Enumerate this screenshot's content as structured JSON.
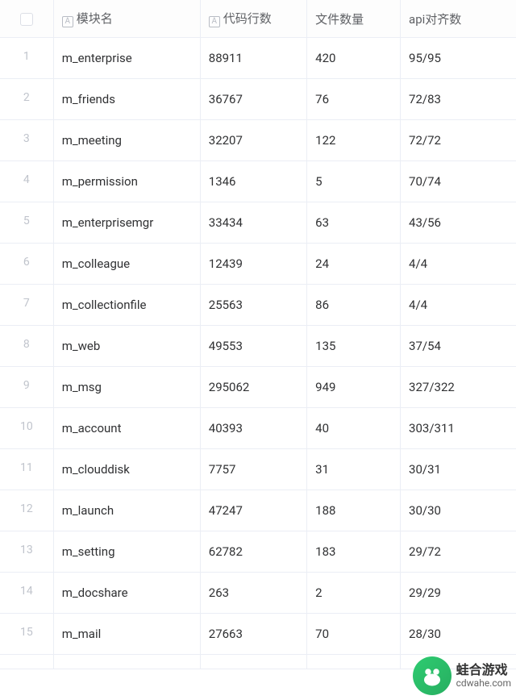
{
  "headers": {
    "module": "模块名",
    "lines": "代码行数",
    "files": "文件数量",
    "api": "api对齐数"
  },
  "rows": [
    {
      "idx": "1",
      "module": "m_enterprise",
      "lines": "88911",
      "files": "420",
      "api": "95/95"
    },
    {
      "idx": "2",
      "module": "m_friends",
      "lines": "36767",
      "files": "76",
      "api": "72/83"
    },
    {
      "idx": "3",
      "module": "m_meeting",
      "lines": "32207",
      "files": "122",
      "api": "72/72"
    },
    {
      "idx": "4",
      "module": "m_permission",
      "lines": "1346",
      "files": "5",
      "api": "70/74"
    },
    {
      "idx": "5",
      "module": "m_enterprisemgr",
      "lines": "33434",
      "files": "63",
      "api": "43/56"
    },
    {
      "idx": "6",
      "module": "m_colleague",
      "lines": "12439",
      "files": "24",
      "api": "4/4"
    },
    {
      "idx": "7",
      "module": "m_collectionfile",
      "lines": "25563",
      "files": "86",
      "api": "4/4"
    },
    {
      "idx": "8",
      "module": "m_web",
      "lines": "49553",
      "files": "135",
      "api": "37/54"
    },
    {
      "idx": "9",
      "module": "m_msg",
      "lines": "295062",
      "files": "949",
      "api": "327/322"
    },
    {
      "idx": "10",
      "module": "m_account",
      "lines": "40393",
      "files": "40",
      "api": "303/311"
    },
    {
      "idx": "11",
      "module": "m_clouddisk",
      "lines": "7757",
      "files": "31",
      "api": "30/31"
    },
    {
      "idx": "12",
      "module": "m_launch",
      "lines": "47247",
      "files": "188",
      "api": "30/30"
    },
    {
      "idx": "13",
      "module": "m_setting",
      "lines": "62782",
      "files": "183",
      "api": "29/72"
    },
    {
      "idx": "14",
      "module": "m_docshare",
      "lines": "263",
      "files": "2",
      "api": "29/29"
    },
    {
      "idx": "15",
      "module": "m_mail",
      "lines": "27663",
      "files": "70",
      "api": "28/30"
    }
  ],
  "watermark": {
    "title": "蛙合游戏",
    "url": "cdwahe.com"
  },
  "icon_label": "A"
}
